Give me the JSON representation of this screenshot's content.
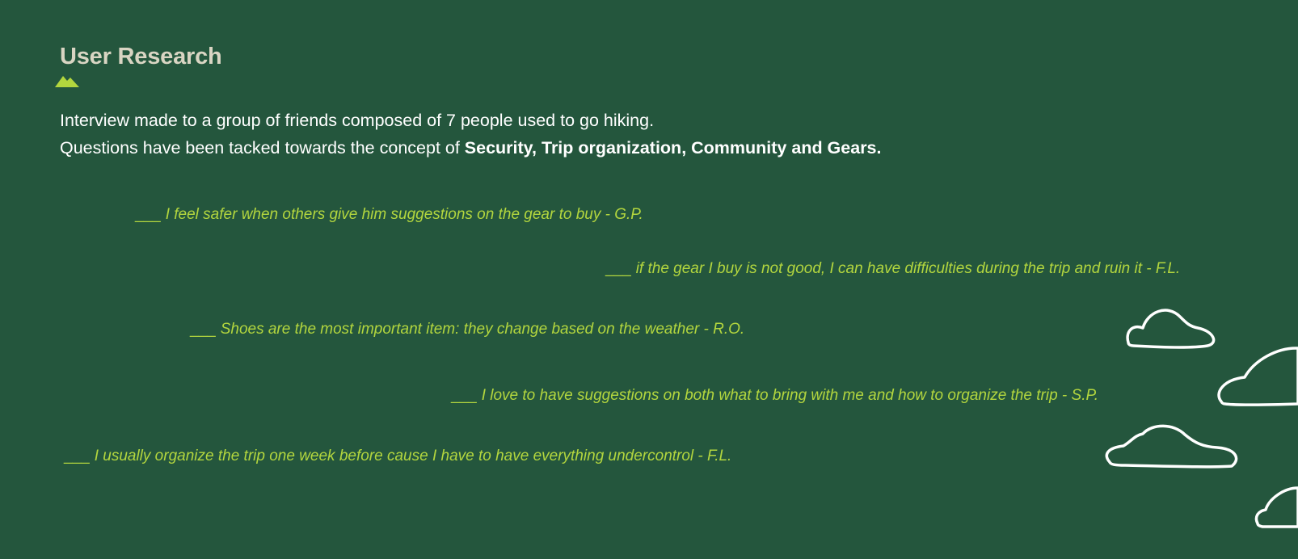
{
  "heading": {
    "title": "User Research"
  },
  "intro": {
    "line1": "Interview made to a group of friends composed of 7 people used to go hiking.",
    "line2_prefix": "Questions have been tacked towards the concept of ",
    "line2_bold": "Security, Trip organization, Community and Gears."
  },
  "quotes": [
    {
      "dash": "___",
      "text": "I feel safer when others give him suggestions on the gear to buy - G.P."
    },
    {
      "dash": "___",
      "text": "if the gear I buy is not good, I can have difficulties during the trip and ruin it - F.L."
    },
    {
      "dash": "___",
      "text": "Shoes are the most important item: they change based on the weather - R.O."
    },
    {
      "dash": "___",
      "text": "I love to have suggestions on both what to bring with me and how to organize the trip - S.P."
    },
    {
      "dash": "___",
      "text": "I usually organize the trip one week before cause I have to have everything undercontrol - F.L."
    }
  ],
  "colors": {
    "background": "#24563d",
    "title": "#d9d5c3",
    "accent": "#b3d63e",
    "text": "#ffffff"
  },
  "icons": {
    "heading_icon": "mountain-icon",
    "decoration": "cloud-icon"
  }
}
